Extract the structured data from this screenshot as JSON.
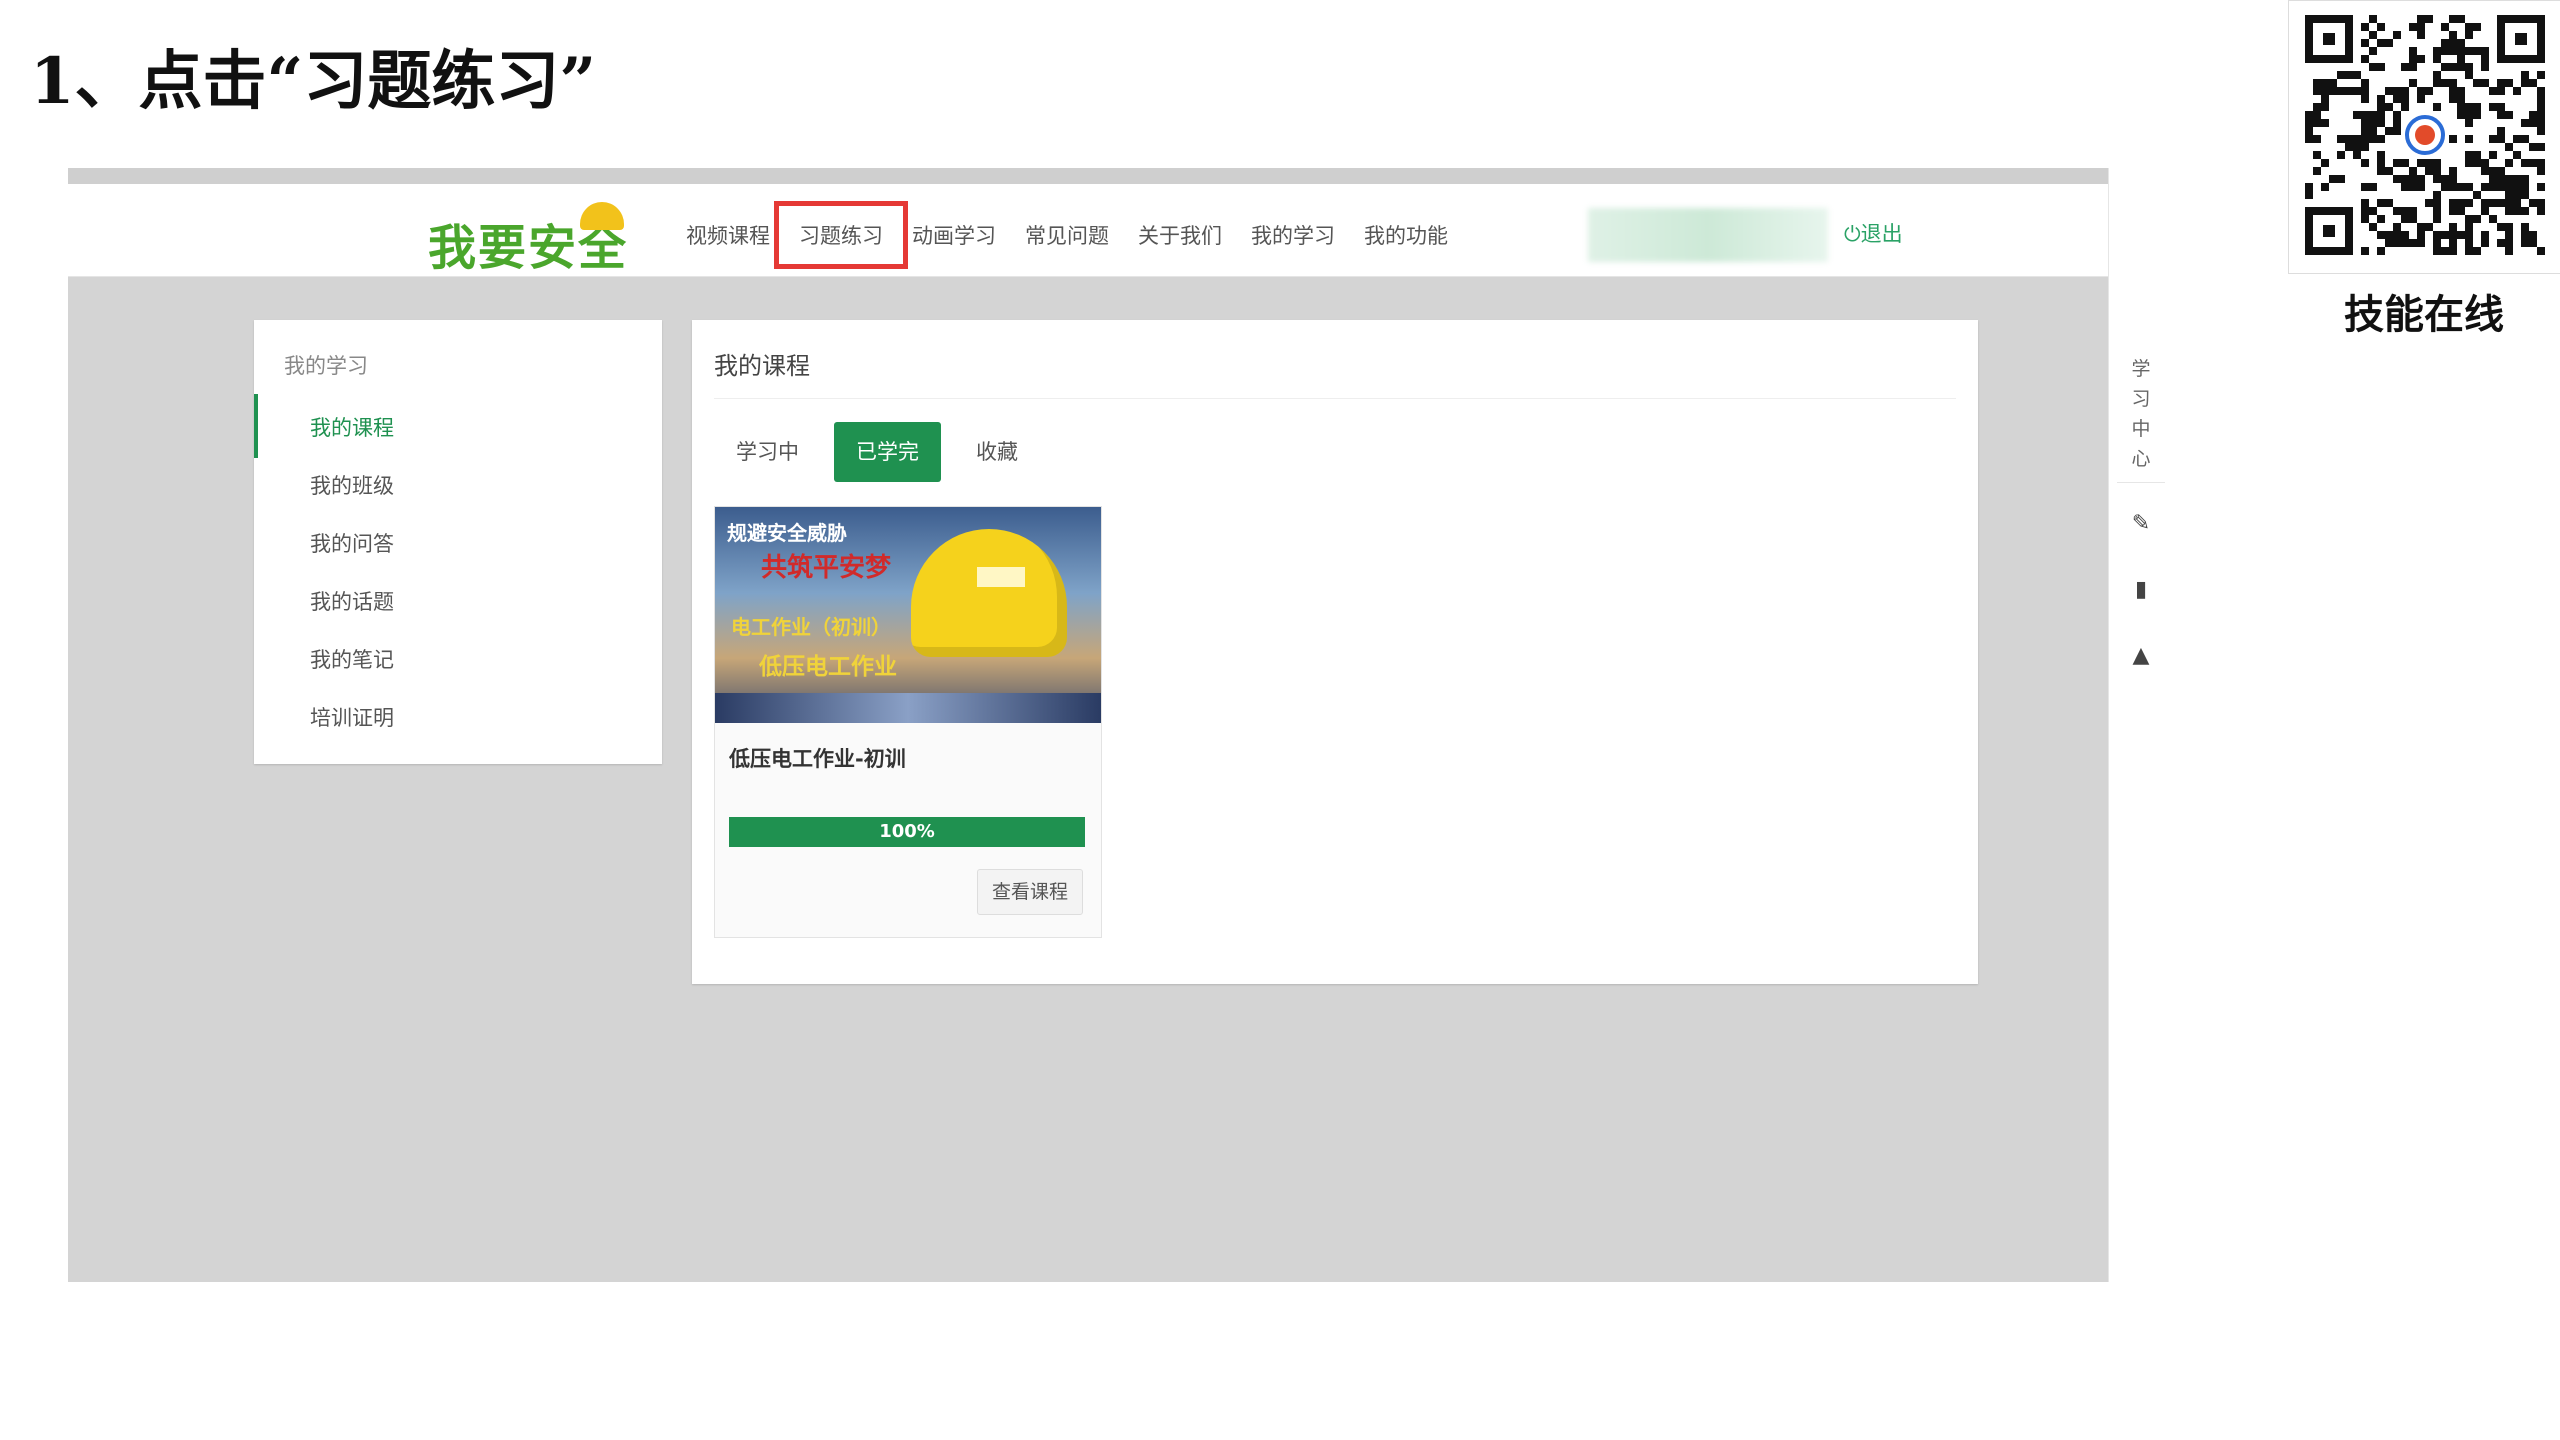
{
  "step": {
    "title": "1、点击“习题练习”"
  },
  "qr": {
    "caption": "技能在线"
  },
  "nav": {
    "brand": "我要安全",
    "items": [
      {
        "label": "视频课程"
      },
      {
        "label": "习题练习",
        "highlighted": true
      },
      {
        "label": "动画学习"
      },
      {
        "label": "常见问题"
      },
      {
        "label": "关于我们"
      },
      {
        "label": "我的学习"
      },
      {
        "label": "我的功能"
      }
    ],
    "logout": "⏻退出"
  },
  "left_menu": {
    "title": "我的学习",
    "items": [
      {
        "label": "我的课程",
        "active": true
      },
      {
        "label": "我的班级"
      },
      {
        "label": "我的问答"
      },
      {
        "label": "我的话题"
      },
      {
        "label": "我的笔记"
      },
      {
        "label": "培训证明"
      }
    ]
  },
  "main": {
    "title": "我的课程",
    "tabs": [
      {
        "label": "学习中"
      },
      {
        "label": "已学完",
        "active": true
      },
      {
        "label": "收藏"
      }
    ],
    "course_card": {
      "image_text": {
        "line1": "规避安全威胁",
        "line2": "共筑平安梦",
        "line3": "电工作业（初训）",
        "line4": "低压电工作业"
      },
      "title": "低压电工作业-初训",
      "progress_percent": 100,
      "progress_label": "100%",
      "button": "查看课程"
    }
  },
  "right_bar": {
    "label": "学习中心",
    "icons": [
      "pencil-icon",
      "book-icon",
      "bell-icon"
    ]
  },
  "colors": {
    "accent": "#1f9150",
    "brand": "#4aa62c",
    "highlight": "#e53935"
  }
}
